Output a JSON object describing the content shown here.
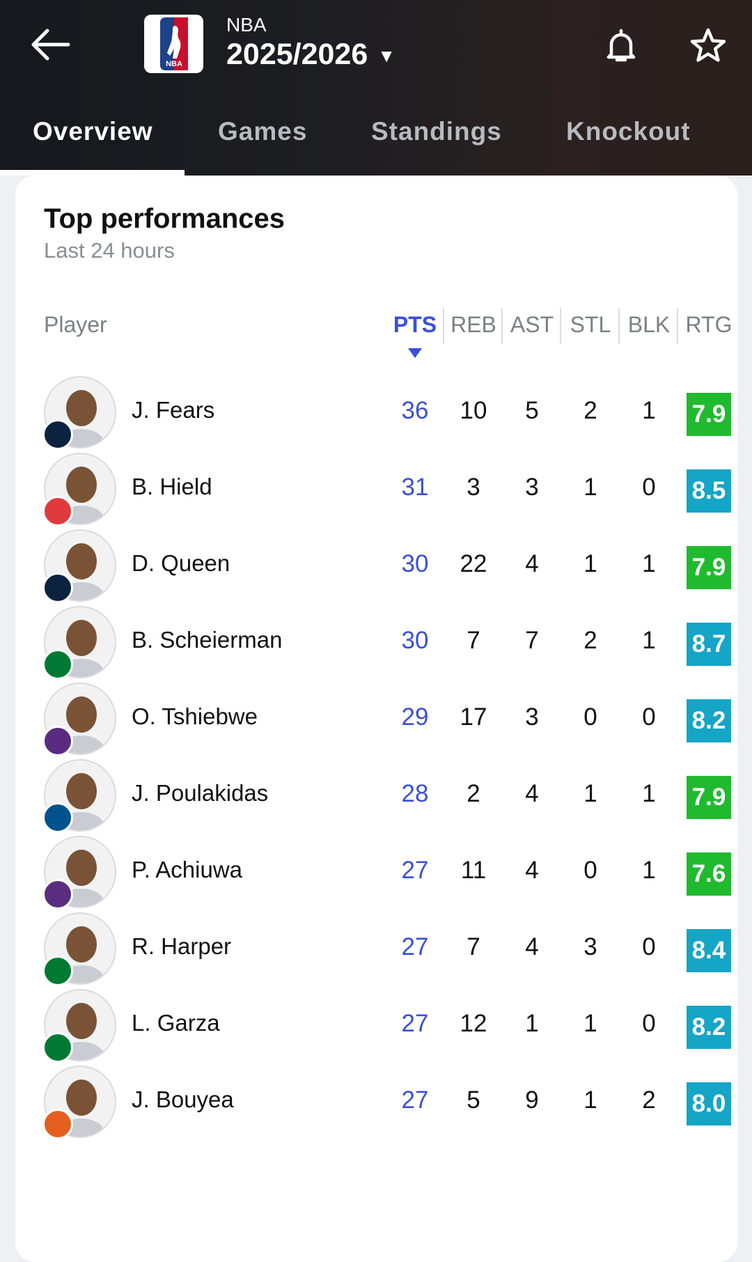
{
  "header": {
    "league": "NBA",
    "season": "2025/2026",
    "logo_text": "NBA"
  },
  "tabs": [
    {
      "label": "Overview",
      "active": true
    },
    {
      "label": "Games",
      "active": false
    },
    {
      "label": "Standings",
      "active": false
    },
    {
      "label": "Knockout",
      "active": false
    }
  ],
  "card": {
    "title": "Top performances",
    "subtitle": "Last 24 hours"
  },
  "columns": {
    "player": "Player",
    "pts": "PTS",
    "reb": "REB",
    "ast": "AST",
    "stl": "STL",
    "blk": "BLK",
    "rtg": "RTG"
  },
  "sort_column": "PTS",
  "colors": {
    "accent": "#3a4fd8",
    "rating_green": "#1fba2e",
    "rating_teal": "#15a5c6"
  },
  "players": [
    {
      "name": "J. Fears",
      "team_icon": "pelicans-logo-icon",
      "pts": "36",
      "reb": "10",
      "ast": "5",
      "stl": "2",
      "blk": "1",
      "rtg": "7.9",
      "rtg_color": "#1fba2e"
    },
    {
      "name": "B. Hield",
      "team_icon": "hawks-logo-icon",
      "pts": "31",
      "reb": "3",
      "ast": "3",
      "stl": "1",
      "blk": "0",
      "rtg": "8.5",
      "rtg_color": "#15a5c6"
    },
    {
      "name": "D. Queen",
      "team_icon": "pelicans-logo-icon",
      "pts": "30",
      "reb": "22",
      "ast": "4",
      "stl": "1",
      "blk": "1",
      "rtg": "7.9",
      "rtg_color": "#1fba2e"
    },
    {
      "name": "B. Scheierman",
      "team_icon": "celtics-logo-icon",
      "pts": "30",
      "reb": "7",
      "ast": "7",
      "stl": "2",
      "blk": "1",
      "rtg": "8.7",
      "rtg_color": "#15a5c6"
    },
    {
      "name": "O. Tshiebwe",
      "team_icon": "jazz-logo-icon",
      "pts": "29",
      "reb": "17",
      "ast": "3",
      "stl": "0",
      "blk": "0",
      "rtg": "8.2",
      "rtg_color": "#15a5c6"
    },
    {
      "name": "J. Poulakidas",
      "team_icon": "mavericks-logo-icon",
      "pts": "28",
      "reb": "2",
      "ast": "4",
      "stl": "1",
      "blk": "1",
      "rtg": "7.9",
      "rtg_color": "#1fba2e"
    },
    {
      "name": "P. Achiuwa",
      "team_icon": "kings-logo-icon",
      "pts": "27",
      "reb": "11",
      "ast": "4",
      "stl": "0",
      "blk": "1",
      "rtg": "7.6",
      "rtg_color": "#1fba2e"
    },
    {
      "name": "R. Harper",
      "team_icon": "celtics-logo-icon",
      "pts": "27",
      "reb": "7",
      "ast": "4",
      "stl": "3",
      "blk": "0",
      "rtg": "8.4",
      "rtg_color": "#15a5c6"
    },
    {
      "name": "L. Garza",
      "team_icon": "celtics-logo-icon",
      "pts": "27",
      "reb": "12",
      "ast": "1",
      "stl": "1",
      "blk": "0",
      "rtg": "8.2",
      "rtg_color": "#15a5c6"
    },
    {
      "name": "J. Bouyea",
      "team_icon": "suns-logo-icon",
      "pts": "27",
      "reb": "5",
      "ast": "9",
      "stl": "1",
      "blk": "2",
      "rtg": "8.0",
      "rtg_color": "#15a5c6"
    }
  ]
}
